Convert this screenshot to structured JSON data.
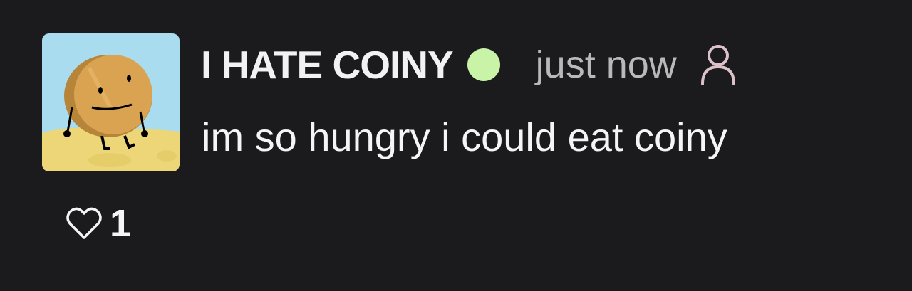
{
  "post": {
    "username": "I HATE COINY",
    "timestamp": "just now",
    "message": "im so hungry i could eat coiny",
    "like_count": "1",
    "online_status_color": "#c9f3a6",
    "avatar_description_icon": "coiny-avatar-icon"
  },
  "colors": {
    "background": "#1b1b1e",
    "text_primary": "#f5f5f5",
    "text_secondary": "#b9b9bc",
    "profile_icon": "#dcc1c8",
    "online_dot": "#c9f3a6"
  },
  "icons": {
    "like": "heart-icon",
    "profile": "person-icon",
    "status": "online-dot-icon"
  }
}
